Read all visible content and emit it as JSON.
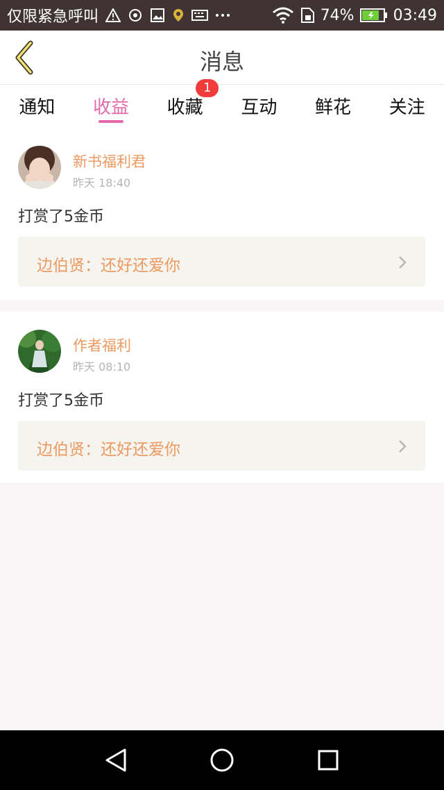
{
  "status_bar": {
    "carrier": "仅限紧急呼叫",
    "battery_percent": "74%",
    "time": "03:49",
    "icons": [
      "warning-icon",
      "nfc-icon",
      "image-icon",
      "location-icon",
      "keyboard-icon",
      "more-icon",
      "wifi-icon",
      "sim-icon",
      "battery-icon"
    ]
  },
  "header": {
    "title": "消息"
  },
  "tabs": [
    {
      "label": "通知",
      "active": false
    },
    {
      "label": "收益",
      "active": true
    },
    {
      "label": "收藏",
      "active": false,
      "badge": "1"
    },
    {
      "label": "互动",
      "active": false
    },
    {
      "label": "鲜花",
      "active": false
    },
    {
      "label": "关注",
      "active": false
    }
  ],
  "messages": [
    {
      "sender": "新书福利君",
      "time": "昨天 18:40",
      "text": "打赏了5金币",
      "quote": "边伯贤：还好还爱你"
    },
    {
      "sender": "作者福利",
      "time": "昨天 08:10",
      "text": "打赏了5金币",
      "quote": "边伯贤：还好还爱你"
    }
  ],
  "colors": {
    "accent": "#e26aa8",
    "sender": "#ec9a61",
    "badge": "#f23b3b",
    "statusbar": "#3f3334"
  }
}
